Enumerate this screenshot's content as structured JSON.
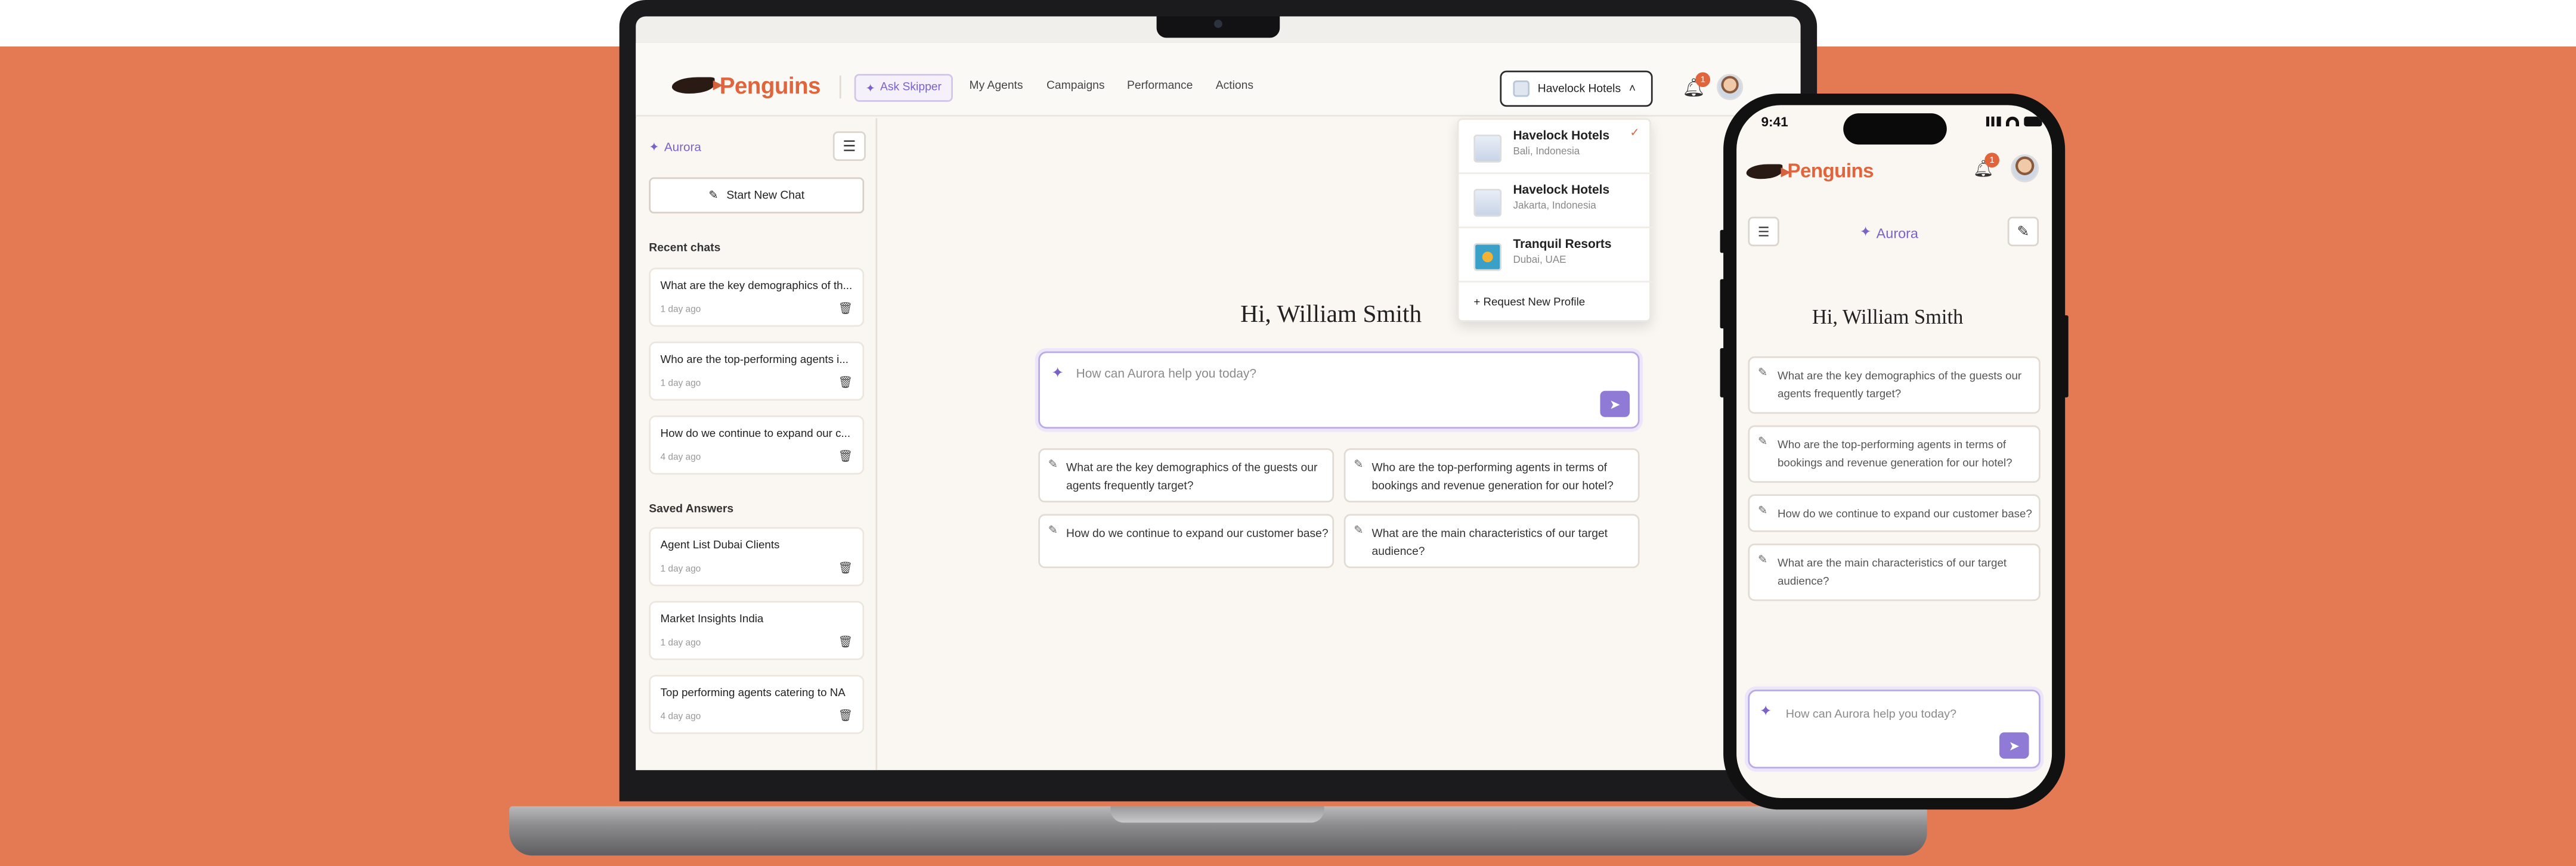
{
  "brand": {
    "name": "Penguins"
  },
  "topnav": {
    "ask_label": "Ask Skipper",
    "items": [
      "My Agents",
      "Campaigns",
      "Performance",
      "Actions"
    ],
    "profile_selected": "Havelock Hotels",
    "notification_count": "1"
  },
  "profiles": [
    {
      "name": "Havelock Hotels",
      "location": "Bali, Indonesia",
      "selected": true
    },
    {
      "name": "Havelock Hotels",
      "location": "Jakarta, Indonesia",
      "selected": false
    },
    {
      "name": "Tranquil Resorts",
      "location": "Dubai, UAE",
      "selected": false
    }
  ],
  "request_profile_label": "Request New Profile",
  "sidebar": {
    "aurora_label": "Aurora",
    "new_chat_label": "Start New Chat",
    "recent_title": "Recent chats",
    "recent": [
      {
        "title": "What are the key demographics of th...",
        "time": "1 day ago"
      },
      {
        "title": "Who are the top-performing agents i...",
        "time": "1 day ago"
      },
      {
        "title": "How do we continue to expand our c...",
        "time": "4 day ago"
      }
    ],
    "saved_title": "Saved Answers",
    "saved": [
      {
        "title": "Agent List Dubai Clients",
        "time": "1 day ago"
      },
      {
        "title": "Market Insights India",
        "time": "1 day ago"
      },
      {
        "title": "Top performing agents catering to NA",
        "time": "4 day ago"
      }
    ]
  },
  "main": {
    "greeting": "Hi, William Smith",
    "prompt_placeholder": "How can Aurora help you today?",
    "suggestions": [
      "What are the key demographics of the guests our agents frequently target?",
      "Who are the top-performing agents in terms of bookings and revenue generation for our hotel?",
      "How do we continue to expand our customer base?",
      "What are the main characteristics of our target audience?"
    ]
  },
  "phone": {
    "status_time": "9:41",
    "header_title": "Aurora"
  },
  "icons": {
    "sparkle": "sparkle-icon",
    "bell": "bell-icon",
    "collapse": "sidebar-collapse-icon",
    "edit": "edit-icon",
    "trash": "trash-icon",
    "send": "send-icon",
    "check": "check-icon",
    "chevron": "chevron-up-icon",
    "plus": "plus-icon",
    "suggestion": "wand-icon"
  },
  "colors": {
    "background": "#e47a54",
    "brand": "#e0643c",
    "accent": "#7b62c9",
    "send": "#8f7ad6"
  }
}
